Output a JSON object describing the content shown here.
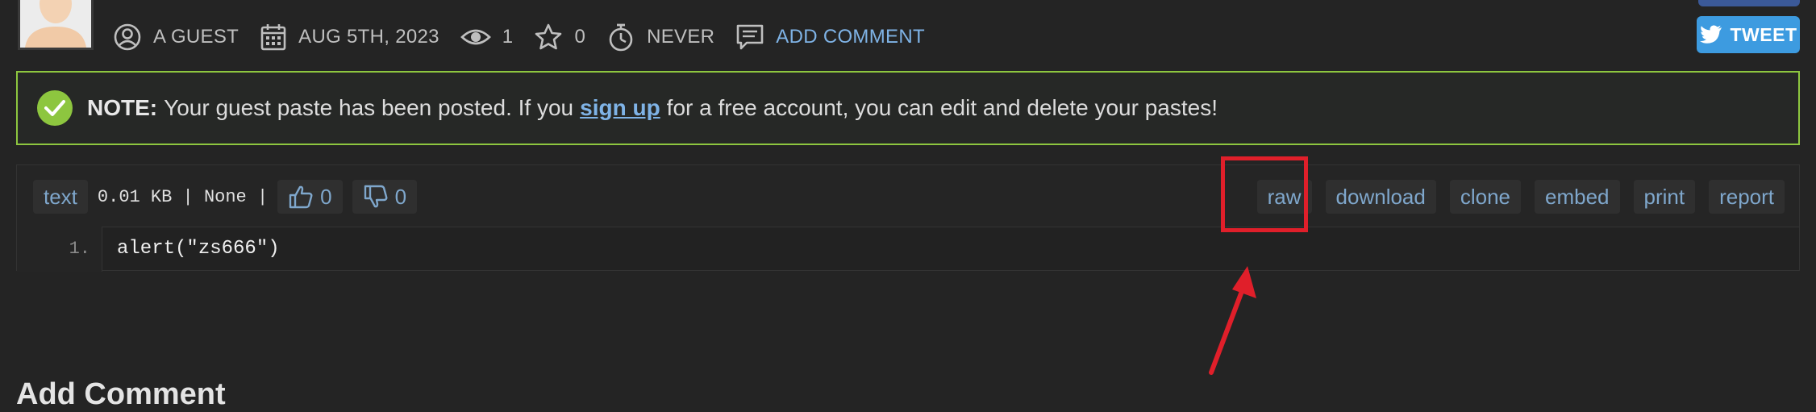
{
  "meta": {
    "author": "A GUEST",
    "date": "AUG 5TH, 2023",
    "views": "1",
    "stars": "0",
    "expiry": "NEVER",
    "add_comment": "ADD COMMENT"
  },
  "social": {
    "tweet_label": "TWEET"
  },
  "note": {
    "label": "NOTE:",
    "text_before": "Your guest paste has been posted. If you",
    "link": "sign up",
    "text_after": "for a free account, you can edit and delete your pastes!"
  },
  "paste": {
    "syntax": "text",
    "info": "0.01 KB | None |",
    "likes": "0",
    "dislikes": "0",
    "actions": [
      "raw",
      "download",
      "clone",
      "embed",
      "print",
      "report"
    ],
    "lines": [
      {
        "number": "1.",
        "code": "alert(\"zs666\")"
      }
    ]
  },
  "section": {
    "add_comment_heading": "Add Comment"
  },
  "colors": {
    "background": "#242424",
    "note_border": "#8dc63f",
    "link": "#7fb3e6",
    "annotation_red": "#e01f2a",
    "tweet": "#3d9be0"
  },
  "icons": [
    "user-icon",
    "calendar-icon",
    "eye-icon",
    "star-icon",
    "timer-icon",
    "comment-icon",
    "twitter-icon",
    "check-icon",
    "thumbs-up-icon",
    "thumbs-down-icon"
  ]
}
